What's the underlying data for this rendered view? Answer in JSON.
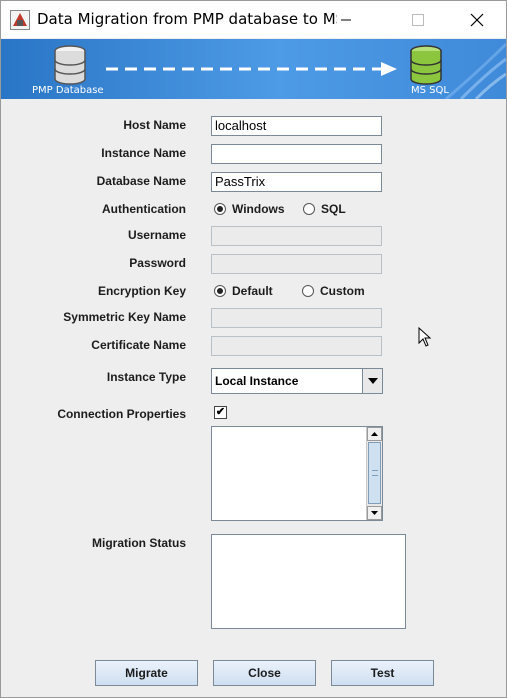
{
  "window": {
    "title": "Data Migration from PMP database to MS ...",
    "controls": {
      "minimize": "—",
      "maximize": "☐",
      "close": "✕"
    }
  },
  "banner": {
    "source_label": "PMP Database",
    "target_label": "MS SQL"
  },
  "form": {
    "host_name": {
      "label": "Host Name",
      "value": "localhost"
    },
    "instance_name": {
      "label": "Instance Name",
      "value": ""
    },
    "database_name": {
      "label": "Database Name",
      "value": "PassTrix"
    },
    "authentication": {
      "label": "Authentication",
      "options": [
        "Windows",
        "SQL"
      ],
      "selected": "Windows"
    },
    "username": {
      "label": "Username",
      "value": ""
    },
    "password": {
      "label": "Password",
      "value": ""
    },
    "encryption_key": {
      "label": "Encryption Key",
      "options": [
        "Default",
        "Custom"
      ],
      "selected": "Default"
    },
    "symmetric_key_name": {
      "label": "Symmetric Key Name",
      "value": ""
    },
    "certificate_name": {
      "label": "Certificate Name",
      "value": ""
    },
    "instance_type": {
      "label": "Instance Type",
      "value": "Local Instance"
    },
    "connection_properties": {
      "label": "Connection Properties",
      "checked": true,
      "check_mark": "✔"
    },
    "migration_status": {
      "label": "Migration Status",
      "value": ""
    }
  },
  "buttons": {
    "migrate": "Migrate",
    "close": "Close",
    "test": "Test"
  },
  "icons": {
    "app": "app-icon",
    "database": "database-icon",
    "dropdown": "chevron-down-icon"
  },
  "colors": {
    "banner": "#3f8ad9",
    "source_db": "#e0e0e0",
    "target_db": "#8cc63f"
  }
}
